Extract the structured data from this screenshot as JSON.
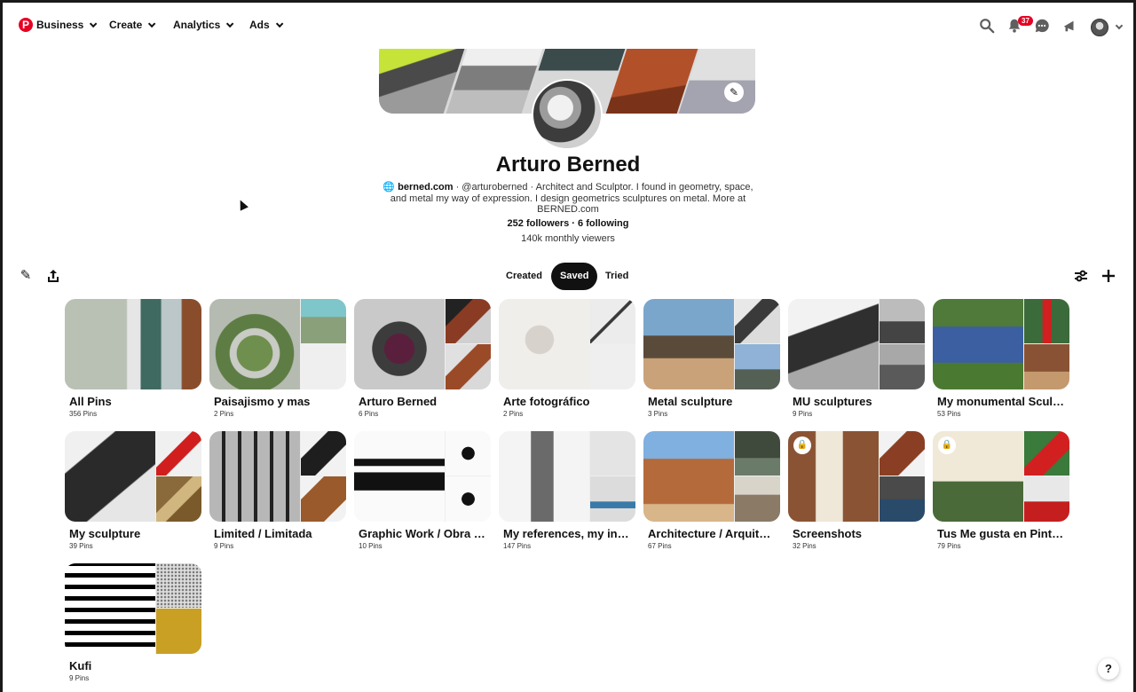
{
  "header": {
    "logo": "P",
    "nav": [
      {
        "label": "Business"
      },
      {
        "label": "Create"
      },
      {
        "label": "Analytics"
      },
      {
        "label": "Ads"
      }
    ],
    "notification_count": "37",
    "icons": [
      "search-icon",
      "bell-icon",
      "messages-icon",
      "updates-icon"
    ]
  },
  "profile": {
    "name": "Arturo Berned",
    "website": "berned.com",
    "bio_rest": "· @arturoberned · Architect and Sculptor. I found in geometry, space, and metal my way of expression. I design geometrics sculptures on metal. More at BERNED.com",
    "followers": "252 followers",
    "following": "6 following",
    "viewers": "140k monthly viewers"
  },
  "tabs": [
    {
      "label": "Created"
    },
    {
      "label": "Saved"
    },
    {
      "label": "Tried"
    }
  ],
  "boards": [
    {
      "title": "All Pins",
      "count": "356 Pins"
    },
    {
      "title": "Paisajismo y mas",
      "count": "2 Pins"
    },
    {
      "title": "Arturo Berned",
      "count": "6 Pins"
    },
    {
      "title": "Arte fotográfico",
      "count": "2 Pins"
    },
    {
      "title": "Metal sculpture",
      "count": "3 Pins"
    },
    {
      "title": "MU sculptures",
      "count": "9 Pins"
    },
    {
      "title": "My monumental Sculptures",
      "count": "53 Pins"
    },
    {
      "title": "My sculpture",
      "count": "39 Pins"
    },
    {
      "title": "Limited / Limitada",
      "count": "9 Pins"
    },
    {
      "title": "Graphic Work / Obra Gráfica",
      "count": "10 Pins"
    },
    {
      "title": "My references, my inspiration",
      "count": "147 Pins"
    },
    {
      "title": "Architecture / Arquitectura",
      "count": "67 Pins"
    },
    {
      "title": "Screenshots",
      "count": "32 Pins"
    },
    {
      "title": "Tus Me gusta en Pinterest",
      "count": "79 Pins"
    },
    {
      "title": "Kufi",
      "count": "9 Pins"
    }
  ],
  "help_label": "?"
}
